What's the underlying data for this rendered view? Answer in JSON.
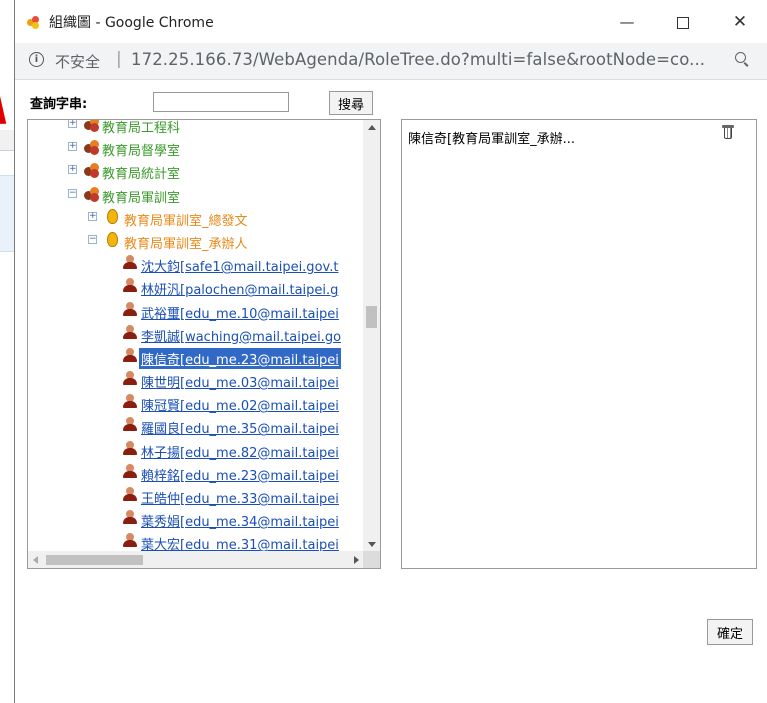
{
  "window": {
    "title": "組織圖 - Google Chrome",
    "minimize_glyph": "—",
    "close_glyph": "✕"
  },
  "address": {
    "security_label": "不安全",
    "separator": "|",
    "url": "172.25.166.73/WebAgenda/RoleTree.do?multi=false&rootNode=co..."
  },
  "search": {
    "label": "查詢字串:",
    "value": "",
    "button": "搜尋"
  },
  "tree": {
    "rows": [
      {
        "label": "教育局工程科",
        "color": "green",
        "icon": "group-icon",
        "expander": "+",
        "level": 1
      },
      {
        "label": "教育局督學室",
        "color": "green",
        "icon": "group-icon",
        "expander": "+",
        "level": 1
      },
      {
        "label": "教育局統計室",
        "color": "green",
        "icon": "group-icon",
        "expander": "+",
        "level": 1
      },
      {
        "label": "教育局軍訓室",
        "color": "green",
        "icon": "group-icon",
        "expander": "−",
        "level": 1
      },
      {
        "label": "教育局軍訓室_總發文",
        "color": "orange",
        "icon": "folder-icon",
        "expander": "+",
        "level": 2
      },
      {
        "label": "教育局軍訓室_承辦人",
        "color": "orange",
        "icon": "folder-icon",
        "expander": "−",
        "level": 2
      },
      {
        "label": "沈大鈞[safe1@mail.taipei.gov.t",
        "color": "blue",
        "icon": "person-icon",
        "level": 3
      },
      {
        "label": "林妍汎[palochen@mail.taipei.g",
        "color": "blue",
        "icon": "person-icon",
        "level": 3
      },
      {
        "label": "武裕璽[edu_me.10@mail.taipei",
        "color": "blue",
        "icon": "person-icon",
        "level": 3
      },
      {
        "label": "李凱誠[waching@mail.taipei.go",
        "color": "blue",
        "icon": "person-icon",
        "level": 3
      },
      {
        "label": "陳信奇[edu_me.23@mail.taipei",
        "color": "blue",
        "icon": "person-icon",
        "level": 3,
        "selected": true
      },
      {
        "label": "陳世明[edu_me.03@mail.taipei",
        "color": "blue",
        "icon": "person-icon",
        "level": 3
      },
      {
        "label": "陳冠賢[edu_me.02@mail.taipei",
        "color": "blue",
        "icon": "person-icon",
        "level": 3
      },
      {
        "label": "羅國良[edu_me.35@mail.taipei",
        "color": "blue",
        "icon": "person-icon",
        "level": 3
      },
      {
        "label": "林子揚[edu_me.82@mail.taipei",
        "color": "blue",
        "icon": "person-icon",
        "level": 3
      },
      {
        "label": "賴梓銘[edu_me.23@mail.taipei",
        "color": "blue",
        "icon": "person-icon",
        "level": 3
      },
      {
        "label": "王皓仲[edu_me.33@mail.taipei",
        "color": "blue",
        "icon": "person-icon",
        "level": 3
      },
      {
        "label": "葉秀娟[edu_me.34@mail.taipei",
        "color": "blue",
        "icon": "person-icon",
        "level": 3
      },
      {
        "label": "葉大宏[edu_me.31@mail.taipei",
        "color": "blue",
        "icon": "person-icon",
        "level": 3
      }
    ]
  },
  "selected": {
    "item": "陳信奇[教育局軍訓室_承辦..."
  },
  "confirm_button": "確定",
  "colors": {
    "green": "#3a9b2a",
    "orange": "#e88a1a",
    "blue": "#1a4fb5",
    "selection": "#3169c6",
    "annotation_arrow": "#e00000"
  }
}
